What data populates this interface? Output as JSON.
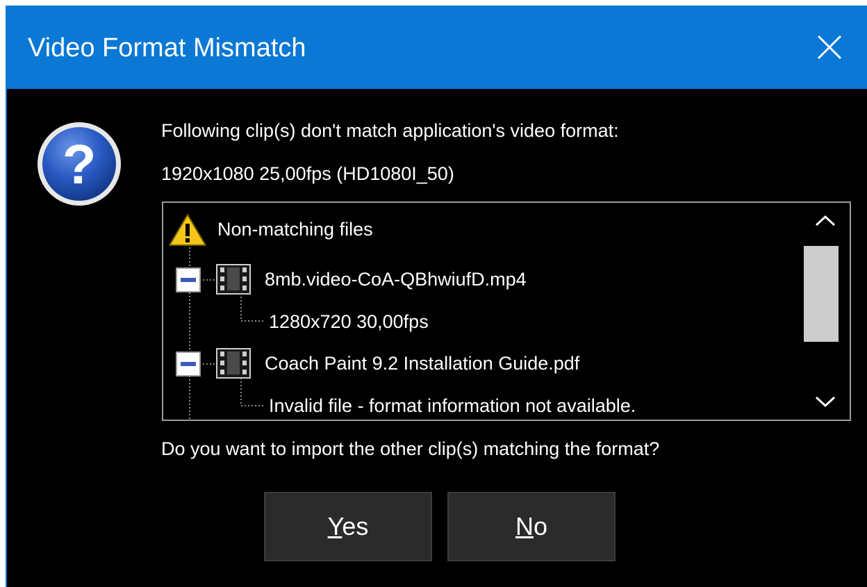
{
  "dialog": {
    "title": "Video Format Mismatch",
    "accent_color": "#0a78d4",
    "close_icon": "close-icon",
    "message_icon": "question-icon",
    "message_line1": "Following clip(s) don't match application's video format:",
    "message_line2": "1920x1080 25,00fps (HD1080I_50)",
    "question": "Do you want to import the other clip(s) matching the format?"
  },
  "tree": {
    "root": {
      "label": "Non-matching files",
      "icon": "warning-icon"
    },
    "items": [
      {
        "name": "8mb.video-CoA-QBhwiufD.mp4",
        "icon": "film-icon",
        "expanded": true,
        "detail": "1280x720 30,00fps"
      },
      {
        "name": "Coach Paint 9.2 Installation Guide.pdf",
        "icon": "film-icon",
        "expanded": true,
        "detail": "Invalid file - format information not available."
      }
    ]
  },
  "buttons": {
    "yes": {
      "accel": "Y",
      "rest": "es"
    },
    "no": {
      "accel": "N",
      "rest": "o"
    }
  }
}
